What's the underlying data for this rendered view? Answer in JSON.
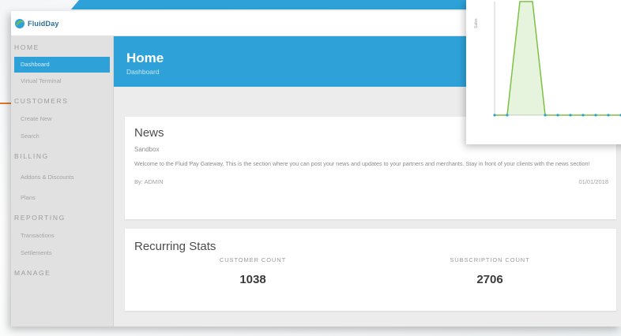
{
  "app": {
    "logo_text": "FluidDay"
  },
  "sidebar": {
    "sections": [
      {
        "heading": "HOME",
        "items": [
          "Dashboard",
          "Virtual Terminal"
        ]
      },
      {
        "heading": "CUSTOMERS",
        "items": [
          "Create New",
          "Search"
        ]
      },
      {
        "heading": "BILLING",
        "items": [
          "Addons & Discounts",
          "Plans"
        ]
      },
      {
        "heading": "REPORTING",
        "items": [
          "Transactions",
          "Settlements"
        ]
      },
      {
        "heading": "MANAGE",
        "items": []
      }
    ],
    "active_item": "Dashboard"
  },
  "header": {
    "title": "Home",
    "subtitle": "Dashboard"
  },
  "news": {
    "title": "News",
    "subtitle": "Sandbox",
    "body": "Welcome to the Fluid Pay Gateway. This is the section where you can post your news and updates to your partners and merchants. Stay in front of your clients with the news section!",
    "author": "By: ADMIN",
    "date": "01/01/2018"
  },
  "stats": {
    "title": "Recurring Stats",
    "customer_label": "CUSTOMER COUNT",
    "customer_value": "1038",
    "subscription_label": "SUBSCRIPTION COUNT",
    "subscription_value": "2706"
  },
  "colors": {
    "brand_blue": "#2ea2d8",
    "accent_orange": "#e8772e",
    "chart_green": "#7cc242"
  },
  "chart_data": {
    "type": "area",
    "ylabel": "Sales",
    "series": [
      {
        "values": [
          0,
          0,
          5,
          5,
          0,
          0,
          0,
          0,
          0,
          0,
          0
        ]
      }
    ],
    "xlabel": ""
  }
}
